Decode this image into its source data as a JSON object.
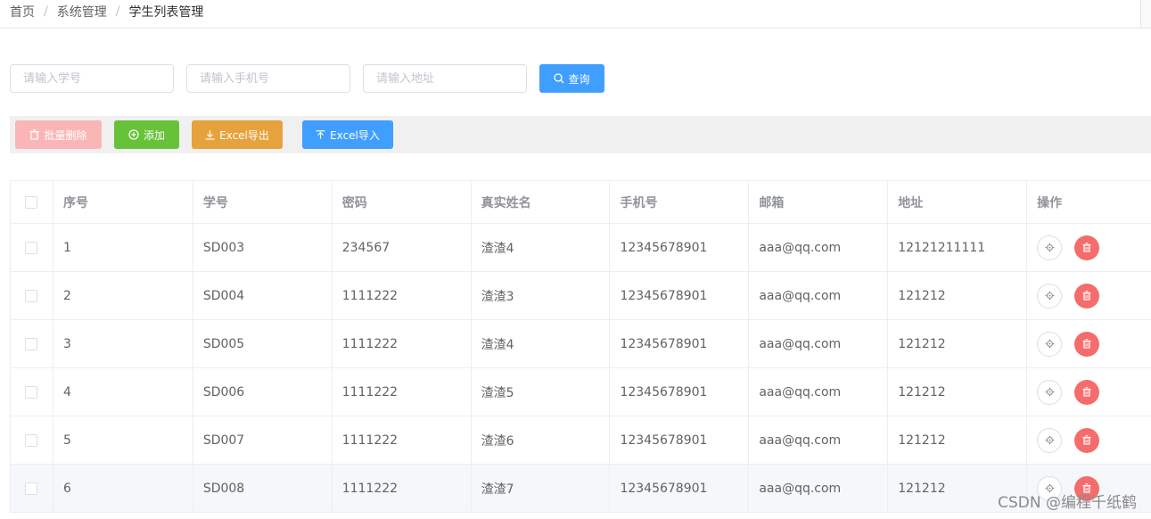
{
  "breadcrumb": [
    "首页",
    "系统管理",
    "学生列表管理"
  ],
  "breadcrumb_separator": "/",
  "search": {
    "student_no_placeholder": "请输入学号",
    "phone_placeholder": "请输入手机号",
    "address_placeholder": "请输入地址",
    "query_label": "查询"
  },
  "toolbar": {
    "batch_delete_label": "批量删除",
    "add_label": "添加",
    "export_label": "Excel导出",
    "import_label": "Excel导入"
  },
  "table": {
    "headers": [
      "序号",
      "学号",
      "密码",
      "真实姓名",
      "手机号",
      "邮箱",
      "地址",
      "操作"
    ],
    "rows": [
      [
        "1",
        "SD003",
        "234567",
        "渣渣4",
        "12345678901",
        "aaa@qq.com",
        "12121211111"
      ],
      [
        "2",
        "SD004",
        "1111222",
        "渣渣3",
        "12345678901",
        "aaa@qq.com",
        "121212"
      ],
      [
        "3",
        "SD005",
        "1111222",
        "渣渣4",
        "12345678901",
        "aaa@qq.com",
        "121212"
      ],
      [
        "4",
        "SD006",
        "1111222",
        "渣渣5",
        "12345678901",
        "aaa@qq.com",
        "121212"
      ],
      [
        "5",
        "SD007",
        "1111222",
        "渣渣6",
        "12345678901",
        "aaa@qq.com",
        "121212"
      ],
      [
        "6",
        "SD008",
        "1111222",
        "渣渣7",
        "12345678901",
        "aaa@qq.com",
        "121212"
      ]
    ]
  },
  "colors": {
    "primary": "#409eff",
    "success": "#67c23a",
    "warning": "#e6a23c",
    "danger": "#f56c6c",
    "danger_disabled": "#fab6b6"
  },
  "watermark": "CSDN @编程千纸鹤"
}
